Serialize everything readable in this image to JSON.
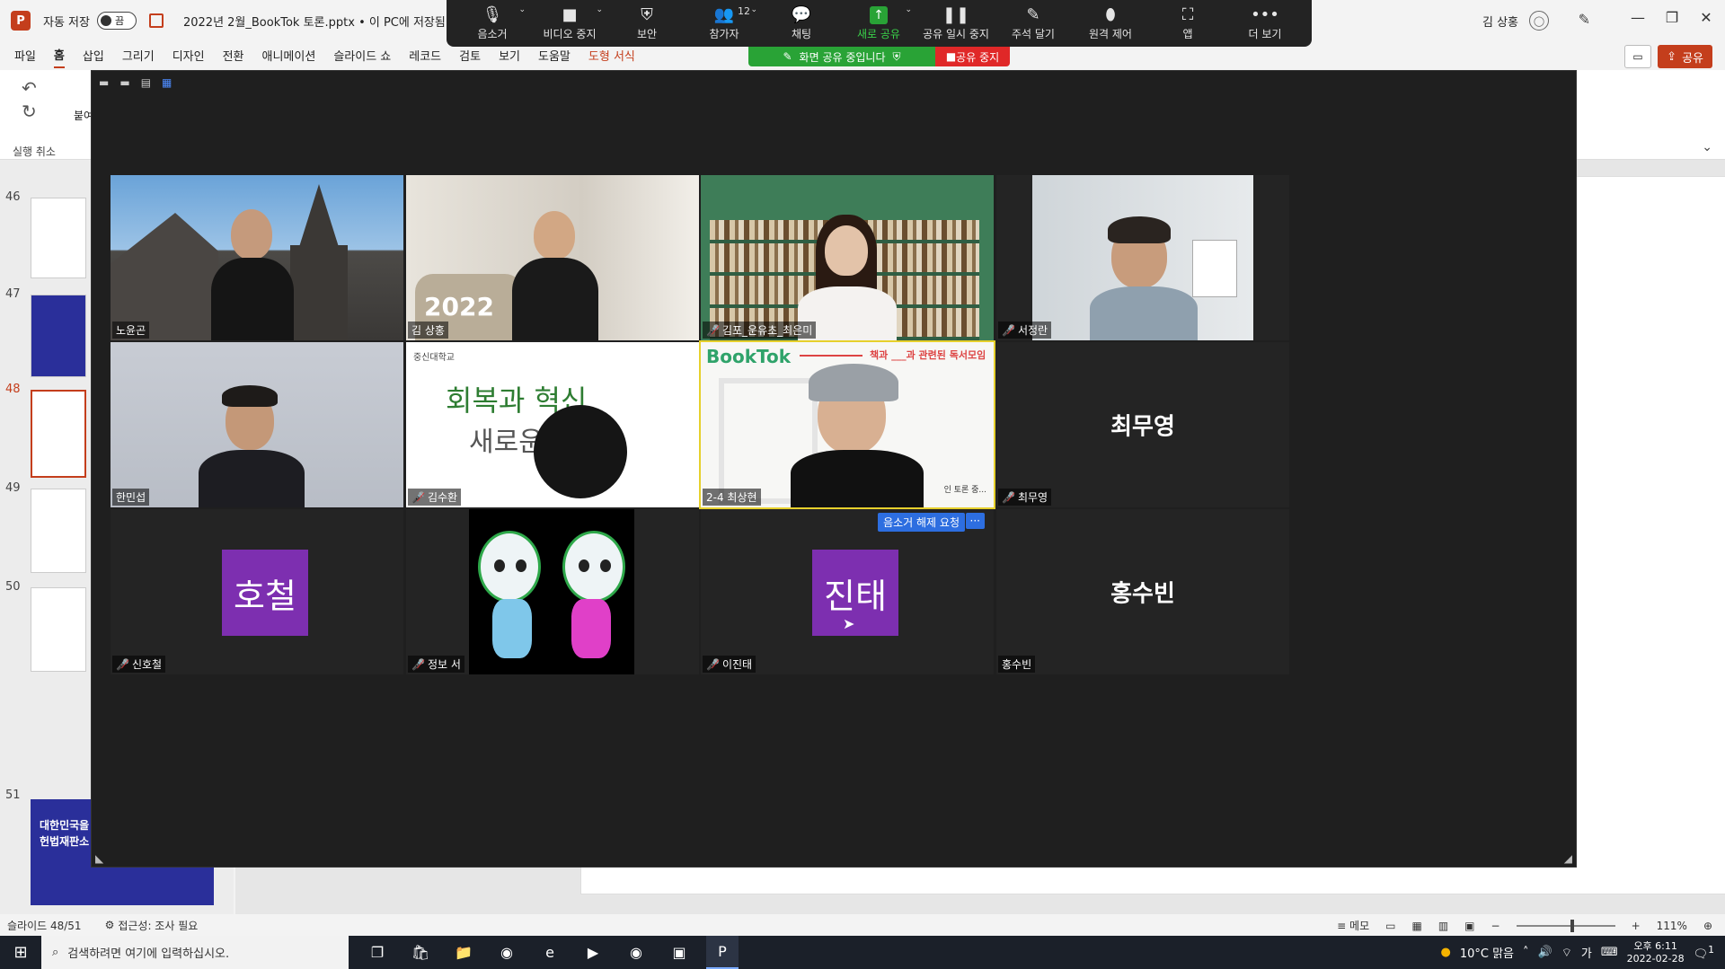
{
  "ppt": {
    "logo": "P",
    "autosave_label": "자동 저장",
    "autosave_state": "끔",
    "doc_title": "2022년 2월_BookTok 토론.pptx • 이 PC에 저장됨",
    "user_name": "김 상홍",
    "ribbon_tabs": [
      "파일",
      "홈",
      "삽입",
      "그리기",
      "디자인",
      "전환",
      "애니메이션",
      "슬라이드 쇼",
      "레코드",
      "검토",
      "보기",
      "도움말",
      "도형 서식"
    ],
    "share_label": "공유",
    "undo_label": "실행 취소",
    "paste_label": "붙여"
  },
  "thumbnails": {
    "numbers": [
      "46",
      "47",
      "48",
      "49",
      "50",
      "51"
    ],
    "thumb51_lines": [
      "대한민국을 빛",
      "헌법재판소 결"
    ]
  },
  "status": {
    "slide_indicator": "슬라이드 48/51",
    "accessibility": "접근성: 조사 필요",
    "notes": "메모",
    "zoom": "111%"
  },
  "zoom_toolbar": {
    "items": [
      {
        "label": "음소거",
        "icon": "microphone-icon"
      },
      {
        "label": "비디오 중지",
        "icon": "video-icon"
      },
      {
        "label": "보안",
        "icon": "shield-icon"
      },
      {
        "label": "참가자",
        "icon": "participants-icon",
        "count": "12"
      },
      {
        "label": "채팅",
        "icon": "chat-icon"
      },
      {
        "label": "새로 공유",
        "icon": "share-icon"
      },
      {
        "label": "공유 일시 중지",
        "icon": "pause-icon"
      },
      {
        "label": "주석 달기",
        "icon": "pen-icon"
      },
      {
        "label": "원격 제어",
        "icon": "mouse-icon"
      },
      {
        "label": "앱",
        "icon": "apps-icon"
      },
      {
        "label": "더 보기",
        "icon": "more-icon"
      }
    ],
    "sharing_banner": "화면 공유 중입니다",
    "stop_share": "공유 중지"
  },
  "participants": [
    {
      "name": "노윤곤",
      "muted": false
    },
    {
      "name": "김 상홍",
      "muted": false
    },
    {
      "name": "김포_운유초_최은미",
      "muted": true
    },
    {
      "name": "서정란",
      "muted": true
    },
    {
      "name": "한민섭",
      "muted": false
    },
    {
      "name": "김수환",
      "muted": true
    },
    {
      "name": "2-4 최상현",
      "muted": false
    },
    {
      "name": "최무영",
      "muted": true,
      "display": "최무영"
    },
    {
      "name": "신호철",
      "muted": true,
      "display": "호철"
    },
    {
      "name": "정보 서",
      "muted": true
    },
    {
      "name": "이진태",
      "muted": true,
      "display": "진태"
    },
    {
      "name": "홍수빈",
      "muted": false,
      "display": "홍수빈"
    }
  ],
  "tile_labels": {
    "unmute_request": "음소거 해제 요청",
    "more": "···",
    "booktok_title": "BookTok",
    "booktok_sub": "책과 ___과 관련된 독서모임",
    "booktok_bottom": "인 토론 중...",
    "school_logo": "중신대학교",
    "school_text_1": "회복과 혁신",
    "school_text_2": "새로운"
  },
  "taskbar": {
    "search_placeholder": "검색하려면 여기에 입력하십시오.",
    "weather": "10°C 맑음",
    "ime": "가",
    "time": "오후 6:11",
    "date": "2022-02-28",
    "notifications": "1"
  },
  "colors": {
    "ppt_accent": "#c43e1c",
    "zoom_bg": "#1f1f1f",
    "share_green": "#29a336",
    "stop_red": "#e02828",
    "avatar_purple": "#7d2fb0",
    "active_speaker": "#e6d02c"
  }
}
